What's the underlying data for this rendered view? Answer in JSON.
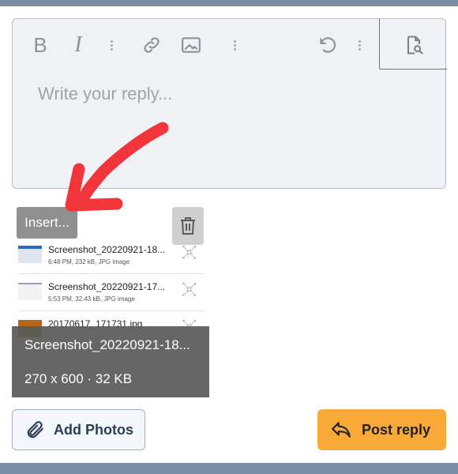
{
  "colors": {
    "frame": "#7b8ea6",
    "editor_bg": "#f0f1f5",
    "post_button": "#f9a938",
    "annotation_arrow": "#f2353a"
  },
  "toolbar": {
    "bold_label": "B",
    "italic_label": "I",
    "icons": [
      "bold-icon",
      "italic-icon",
      "more-vertical-icon",
      "link-icon",
      "image-icon",
      "more-vertical-icon",
      "undo-icon",
      "more-vertical-icon",
      "preview-icon"
    ]
  },
  "editor": {
    "placeholder": "Write your reply..."
  },
  "attachments": {
    "insert_label": "Insert...",
    "files": [
      {
        "name": "Screenshot_20220921-18...",
        "meta": "6:48 PM, 232 kB, JPG image"
      },
      {
        "name": "Screenshot_20220921-17...",
        "meta": "5:53 PM, 32.43 kB, JPG image"
      },
      {
        "name": "20170617_171731.jpg",
        "meta": ""
      }
    ],
    "overlay_name": "Screenshot_20220921-18...",
    "overlay_info": "270 x 600 · 32 KB"
  },
  "actions": {
    "add_photos_label": "Add Photos",
    "post_reply_label": "Post reply"
  }
}
